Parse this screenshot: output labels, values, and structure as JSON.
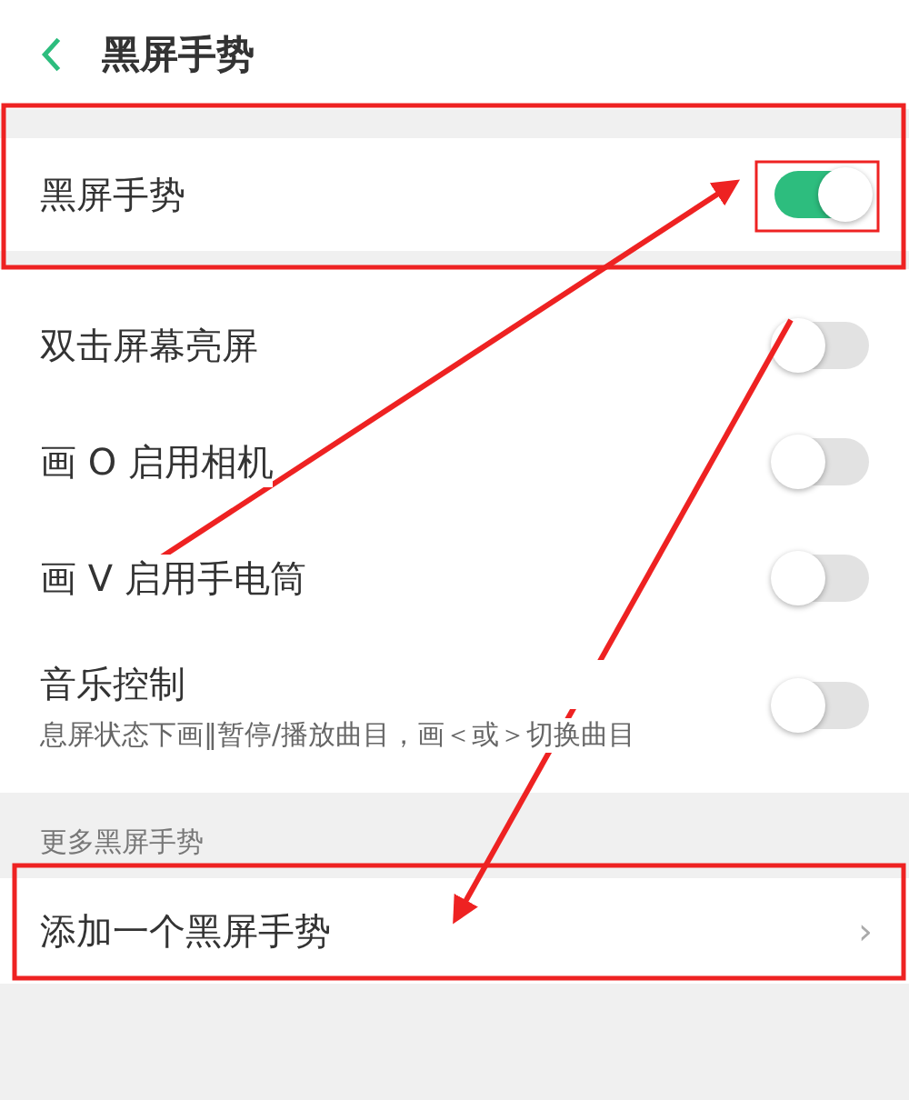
{
  "header": {
    "title": "黑屏手势"
  },
  "master": {
    "label": "黑屏手势",
    "on": true
  },
  "gestures": [
    {
      "label": "双击屏幕亮屏",
      "on": false
    },
    {
      "label": "画 O 启用相机",
      "on": false
    },
    {
      "label": "画 V 启用手电筒",
      "on": false
    },
    {
      "label": "音乐控制",
      "description": "息屏状态下画‖暂停/播放曲目，画＜或＞切换曲目",
      "on": false
    }
  ],
  "more": {
    "heading": "更多黑屏手势",
    "items": [
      {
        "label": "添加一个黑屏手势",
        "chevron": "›"
      }
    ]
  }
}
